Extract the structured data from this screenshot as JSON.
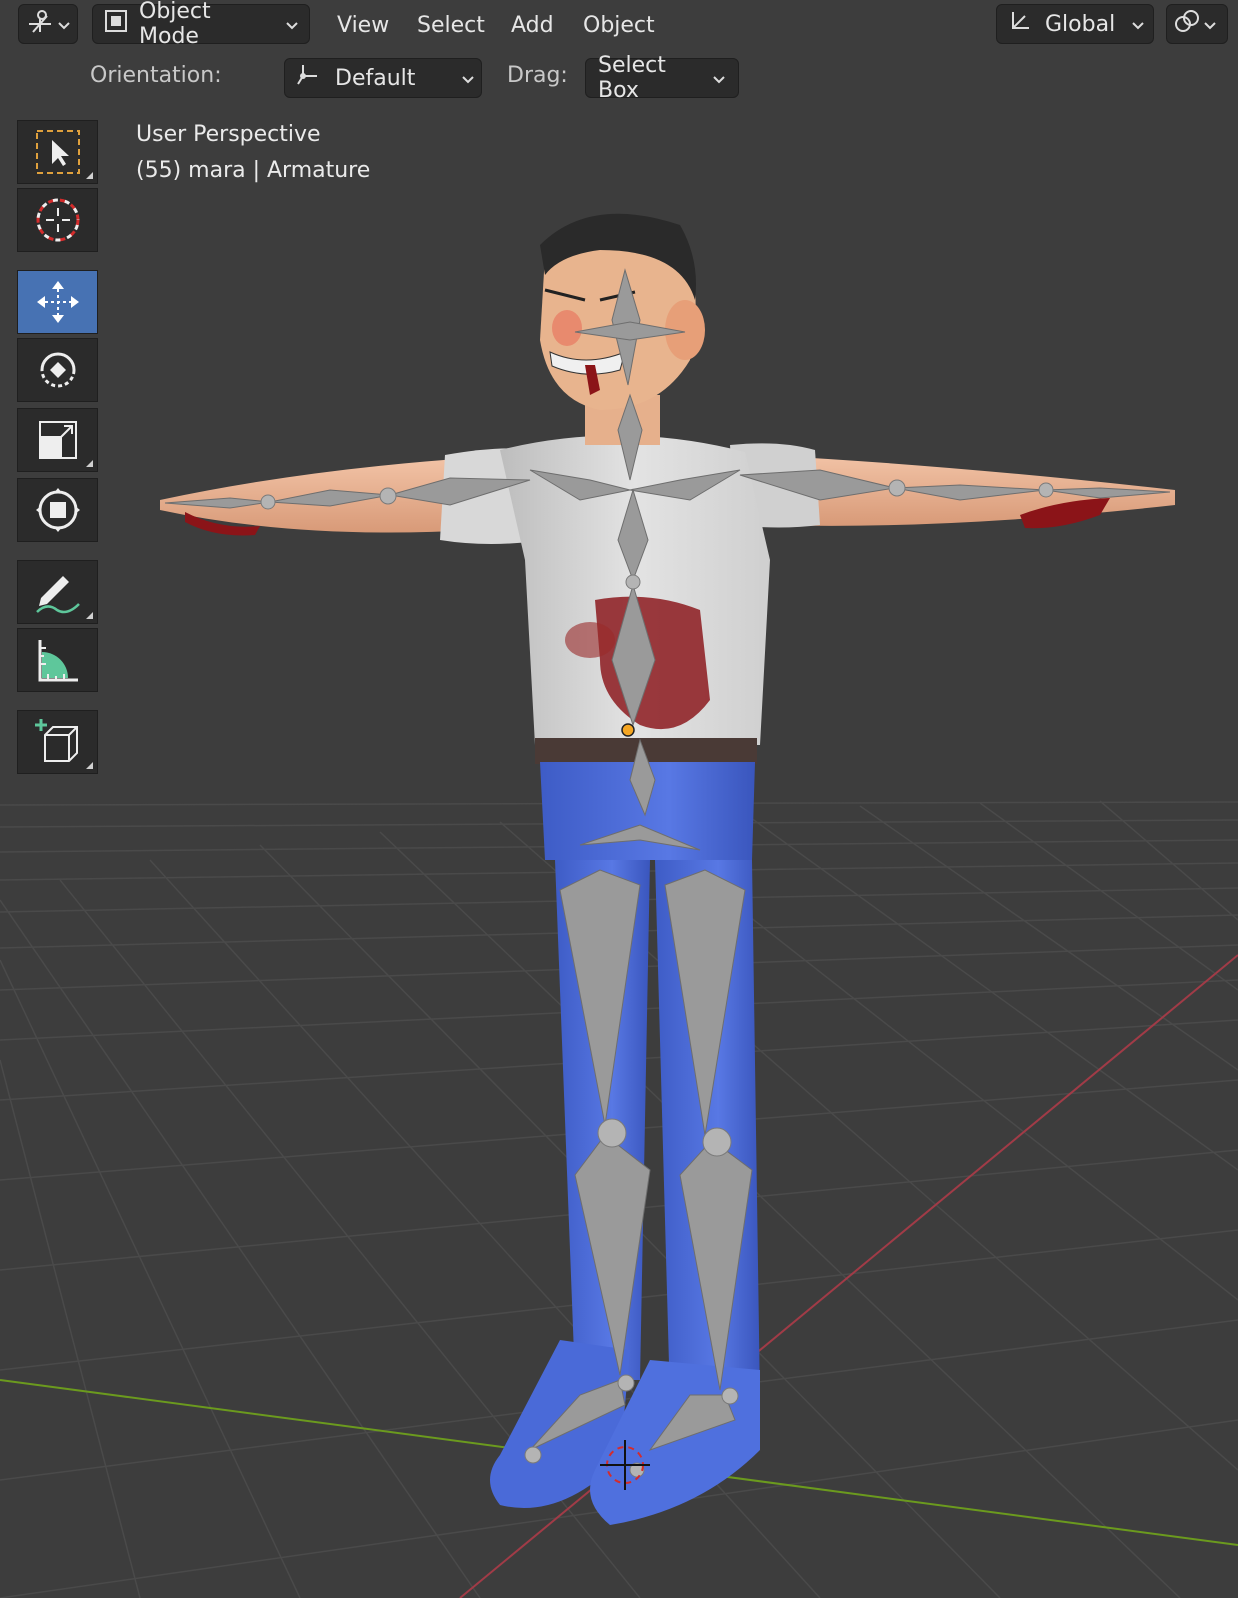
{
  "header": {
    "editor_type_icon": "viewport-icon",
    "mode": "Object Mode",
    "menus": [
      "View",
      "Select",
      "Add",
      "Object"
    ],
    "transform_orientation": "Global"
  },
  "tool_settings": {
    "orientation_label": "Orientation:",
    "orientation_value": "Default",
    "drag_label": "Drag:",
    "drag_value": "Select Box"
  },
  "viewport": {
    "view_name": "User Perspective",
    "object_info": "(55) mara | Armature"
  },
  "toolbar": {
    "tools": [
      "select-box",
      "cursor",
      "move",
      "rotate",
      "scale",
      "transform",
      "annotate",
      "measure",
      "add-cube"
    ],
    "active": "move"
  },
  "colors": {
    "background": "#3d3d3d",
    "grid": "#4a4a4a",
    "x_axis": "#a13b47",
    "y_axis": "#6b9a1e",
    "active_tool": "#4772b3",
    "pants": "#4a6ad8",
    "shirt": "#dcdcdc",
    "skin": "#e9b08a",
    "bone": "#9a9a9a"
  }
}
